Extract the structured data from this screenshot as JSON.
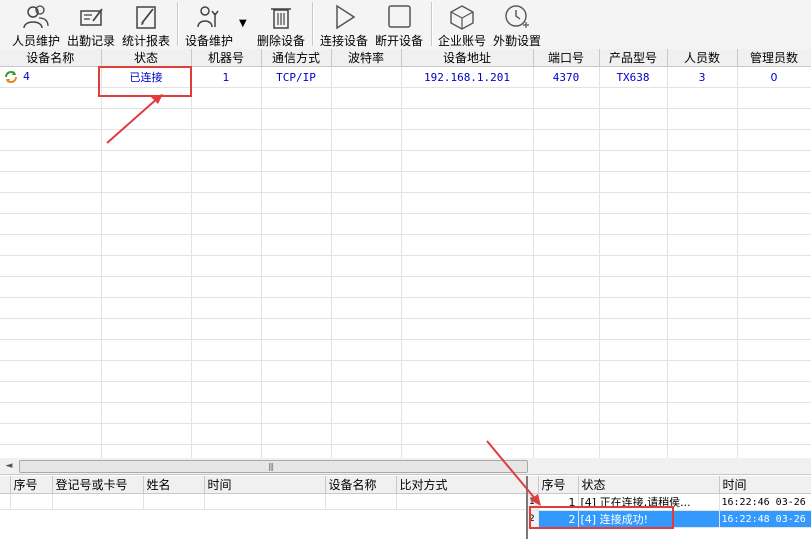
{
  "toolbar": {
    "items": [
      {
        "label": "人员维护",
        "icon": "users-icon"
      },
      {
        "label": "出勤记录",
        "icon": "records-icon"
      },
      {
        "label": "统计报表",
        "icon": "report-icon"
      },
      {
        "label": "设备维护",
        "icon": "device-maintenance-icon"
      },
      {
        "label": "删除设备",
        "icon": "trash-icon"
      },
      {
        "label": "连接设备",
        "icon": "play-icon"
      },
      {
        "label": "断开设备",
        "icon": "stop-icon"
      },
      {
        "label": "企业账号",
        "icon": "cube-icon"
      },
      {
        "label": "外勤设置",
        "icon": "clock-icon"
      }
    ],
    "dropdown_glyph": "▼"
  },
  "device_table": {
    "columns": [
      "设备名称",
      "状态",
      "机器号",
      "通信方式",
      "波特率",
      "设备地址",
      "端口号",
      "产品型号",
      "人员数",
      "管理员数"
    ],
    "rows": [
      {
        "name": "4",
        "status": "已连接",
        "machine_no": "1",
        "comm": "TCP/IP",
        "baud": "",
        "address": "192.168.1.201",
        "port": "4370",
        "model": "TX638",
        "users": "3",
        "admins": "0"
      }
    ]
  },
  "scrollbar": {
    "left_arrow": "◄",
    "grip": "|||"
  },
  "records_table": {
    "columns": [
      "序号",
      "登记号或卡号",
      "姓名",
      "时间",
      "设备名称",
      "比对方式"
    ]
  },
  "log_table": {
    "columns": [
      "序号",
      "状态",
      "时间"
    ],
    "rows": [
      {
        "row_header": "1",
        "seq": "1",
        "status": "[4] 正在连接,请稍侯...",
        "time": "16:22:46 03-26"
      },
      {
        "row_header": "2",
        "seq": "2",
        "status": "[4] 连接成功!",
        "time": "16:22:48 03-26"
      }
    ],
    "selected_row": 2
  },
  "colors": {
    "highlight": "#e03c3c",
    "selection": "#3399ff",
    "link_text": "#0000cc"
  }
}
